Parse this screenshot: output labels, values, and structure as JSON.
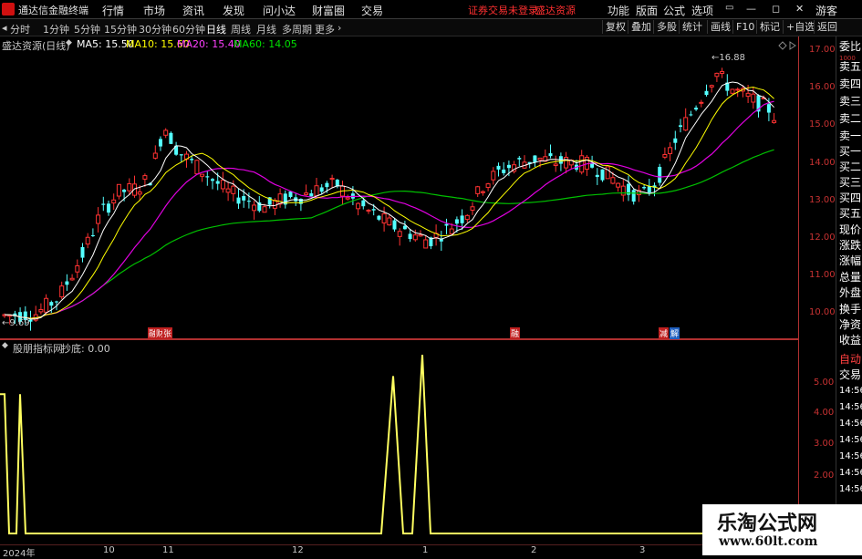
{
  "menubar": {
    "app_title": "通达信金融终端",
    "items": [
      "行情",
      "市场",
      "资讯",
      "发现",
      "问小达",
      "财富圈",
      "交易"
    ],
    "warning": "证券交易未登录",
    "broker": "盛达资源",
    "right_items": [
      "功能",
      "版面",
      "公式",
      "选项"
    ],
    "guest": "游客"
  },
  "toolbar": {
    "periods": [
      "分时",
      "1分钟",
      "5分钟",
      "15分钟",
      "30分钟",
      "60分钟",
      "日线",
      "周线",
      "月线",
      "多周期",
      "更多"
    ],
    "selected": "日线",
    "right_buttons": [
      "复权",
      "叠加",
      "多股",
      "统计",
      "画线",
      "F10",
      "标记",
      "+自选",
      "返回"
    ]
  },
  "main_chart": {
    "stock_label": "盛达资源(日线)",
    "ma5": "MA5: 15.50",
    "ma10": "MA10: 15.60",
    "ma20": "MA20: 15.40",
    "ma60": "MA60: 14.05",
    "high_label": "16.88",
    "low_label": "9.69",
    "y_ticks": [
      "17.00",
      "16.00",
      "15.00",
      "14.00",
      "13.00",
      "12.00",
      "11.00",
      "10.00"
    ],
    "markers": [
      "融",
      "财",
      "张",
      "融",
      "减",
      "解"
    ],
    "colors": {
      "ma5": "#ffffff",
      "ma10": "#ffff00",
      "ma20": "#ff00ff",
      "ma60": "#00c000",
      "up": "#ff3232",
      "down": "#54ffff"
    }
  },
  "indicator": {
    "name": "股朋指标网",
    "param": "抄底: 0.00",
    "y_ticks": [
      "5.00",
      "4.00",
      "3.00",
      "2.00"
    ]
  },
  "right_panel": {
    "items": [
      "委比",
      "卖五",
      "卖四",
      "卖三",
      "卖二",
      "卖一",
      "买一",
      "买二",
      "买三",
      "买四",
      "买五",
      "现价",
      "涨跌",
      "涨幅",
      "总量",
      "外盘",
      "换手",
      "净资",
      "收益"
    ],
    "lower_items": [
      "自动",
      "交易"
    ],
    "times": [
      "14:56",
      "14:56",
      "14:56",
      "14:56",
      "14:56",
      "14:56",
      "14:56"
    ]
  },
  "time_axis": {
    "labels": [
      "2024年",
      "10",
      "11",
      "12",
      "1",
      "2",
      "3"
    ]
  },
  "watermark": {
    "title": "乐淘公式网",
    "url": "www.60lt.com"
  }
}
